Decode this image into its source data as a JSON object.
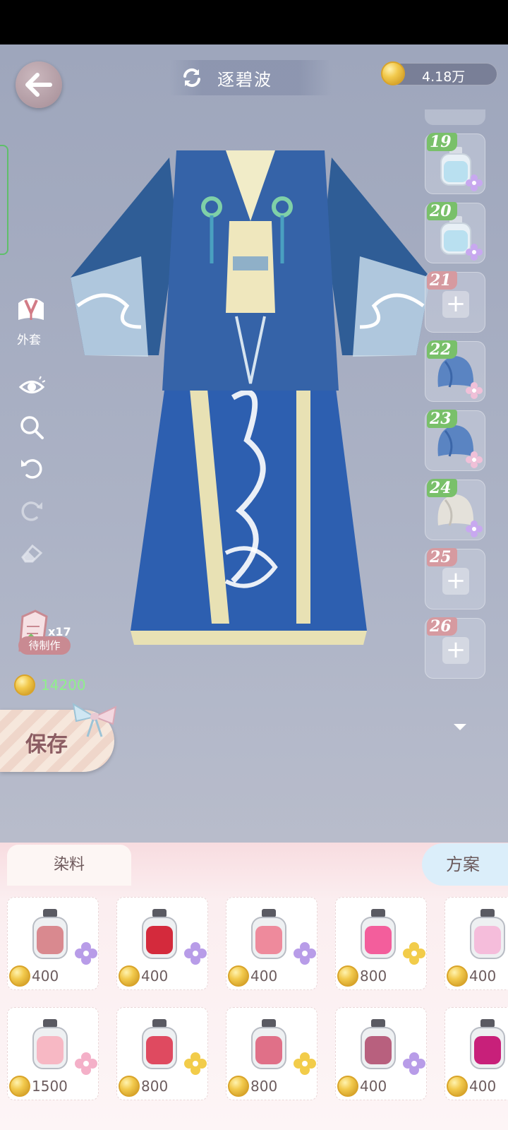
{
  "header": {
    "title": "逐碧波",
    "currency_amount": "4.18万",
    "back_icon": "back-arrow-icon",
    "swap_icon": "swap-icon"
  },
  "left_tools": {
    "category_label": "外套",
    "craft_count": "x17",
    "craft_label": "待制作",
    "cost_value": "14200",
    "save_label": "保存"
  },
  "slots": [
    {
      "number": "19",
      "state": "filled",
      "item": "bottle-light-blue",
      "badge": "green"
    },
    {
      "number": "20",
      "state": "filled",
      "item": "bottle-light-blue",
      "badge": "green"
    },
    {
      "number": "21",
      "state": "empty",
      "badge": "red"
    },
    {
      "number": "22",
      "state": "filled",
      "item": "blue-fabric",
      "badge": "green"
    },
    {
      "number": "23",
      "state": "filled",
      "item": "blue-fabric",
      "badge": "green"
    },
    {
      "number": "24",
      "state": "filled",
      "item": "white-fabric",
      "badge": "green"
    },
    {
      "number": "25",
      "state": "empty",
      "badge": "red"
    },
    {
      "number": "26",
      "state": "empty",
      "badge": "red"
    }
  ],
  "tabs": {
    "dye_label": "染料",
    "plan_label": "方案"
  },
  "dyes": [
    {
      "color": "#d9898f",
      "price": "400",
      "flower": "purple"
    },
    {
      "color": "#d42a3c",
      "price": "400",
      "flower": "purple"
    },
    {
      "color": "#ee8a9c",
      "price": "400",
      "flower": "purple"
    },
    {
      "color": "#f35e9c",
      "price": "800",
      "flower": "gold"
    },
    {
      "color": "#f5bddb",
      "price": "400",
      "flower": "purple"
    },
    {
      "color": "#f7b8c4",
      "price": "1500",
      "flower": "rainbow"
    },
    {
      "color": "#df4a60",
      "price": "800",
      "flower": "gold"
    },
    {
      "color": "#e07088",
      "price": "800",
      "flower": "gold"
    },
    {
      "color": "#b8607e",
      "price": "400",
      "flower": "purple"
    },
    {
      "color": "#c8207a",
      "price": "400",
      "flower": "purple"
    }
  ]
}
